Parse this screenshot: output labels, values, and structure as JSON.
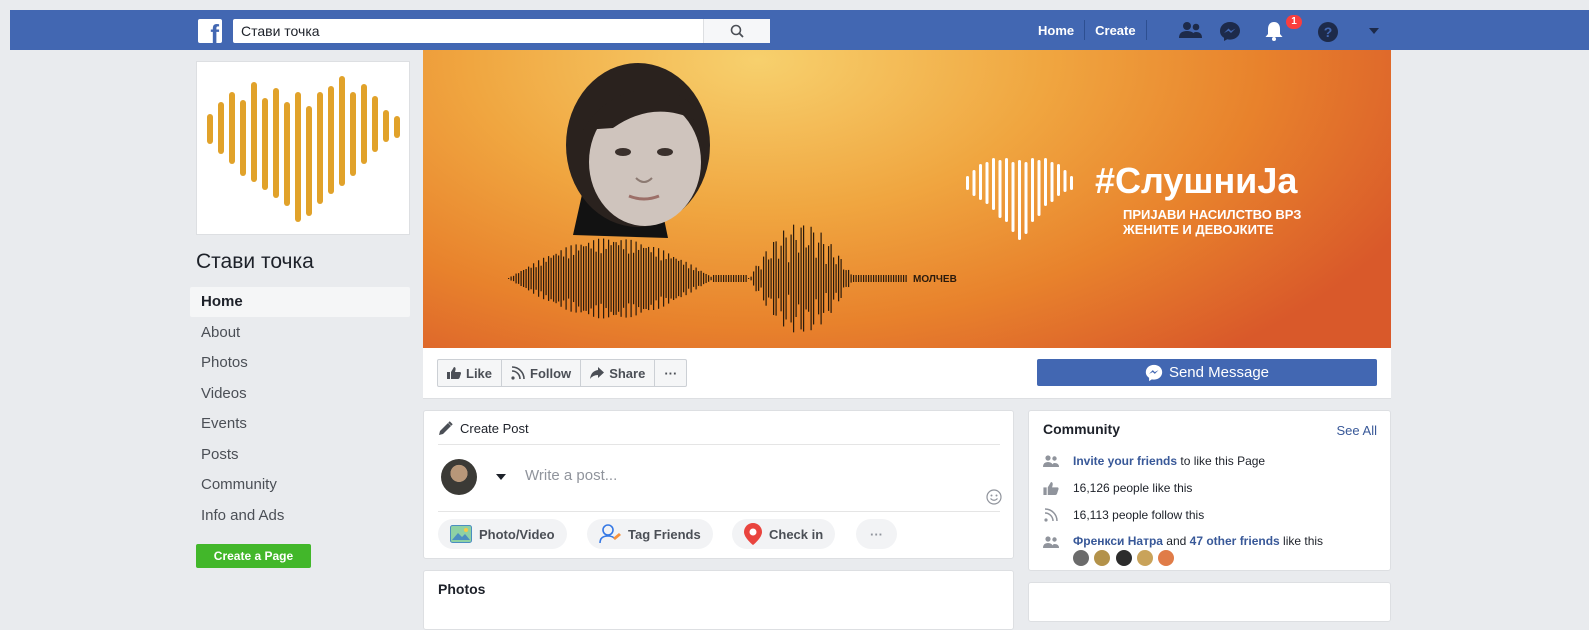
{
  "topbar": {
    "logo_letter": "f",
    "search_value": "Стави точка",
    "home_label": "Home",
    "create_label": "Create",
    "notifications_count": "1"
  },
  "page": {
    "name": "Стави точка"
  },
  "sidebar": {
    "items": [
      {
        "label": "Home"
      },
      {
        "label": "About"
      },
      {
        "label": "Photos"
      },
      {
        "label": "Videos"
      },
      {
        "label": "Events"
      },
      {
        "label": "Posts"
      },
      {
        "label": "Community"
      },
      {
        "label": "Info and Ads"
      }
    ],
    "create_page_label": "Create a Page"
  },
  "cover": {
    "hashtag": "#СлушниЈа",
    "line1": "ПРИЈАВИ НАСИЛСТВО ВРЗ",
    "line2": "ЖЕНИТЕ И ДЕВОЈКИТЕ",
    "wave_label": "МОЛЧЕВ"
  },
  "actions": {
    "like": "Like",
    "follow": "Follow",
    "share": "Share",
    "more": "···",
    "send_message": "Send Message"
  },
  "create_post": {
    "title": "Create Post",
    "placeholder": "Write a post...",
    "photo_video": "Photo/Video",
    "tag_friends": "Tag Friends",
    "check_in": "Check in",
    "more": "···"
  },
  "photos": {
    "title": "Photos"
  },
  "community": {
    "title": "Community",
    "see_all": "See All",
    "invite_link": "Invite your friends",
    "invite_rest": "to like this Page",
    "likes": "16,126 people like this",
    "follows": "16,113 people follow this",
    "friend_name": "Френкси Натра",
    "and": "and",
    "others_link": "47 other friends",
    "like_this": "like this"
  },
  "colors": {
    "brand_blue": "#4267b2",
    "create_green": "#42b72a",
    "accent_orange": "#e08a2a",
    "badge_red": "#fa3e3e"
  }
}
